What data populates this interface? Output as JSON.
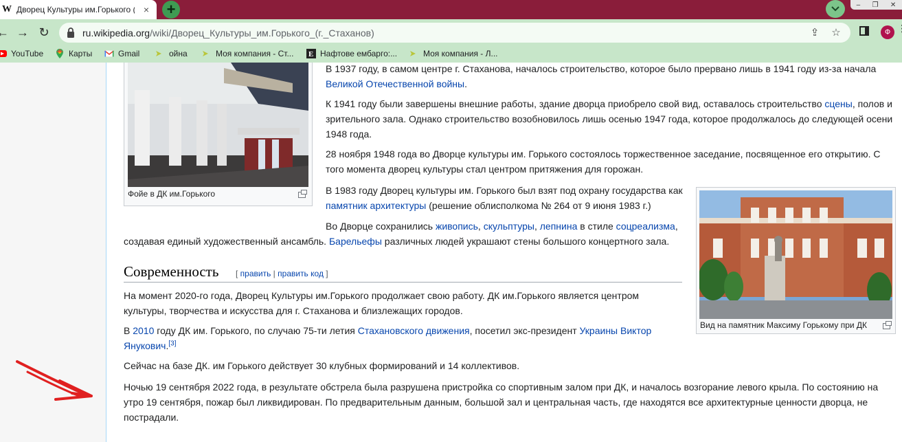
{
  "browser": {
    "tab_title": "Дворец Культуры им.Горького (",
    "tab_favicon": "W",
    "tab_close": "×",
    "new_tab": "+",
    "profile_letter": "Ф",
    "url_host": "ru.wikipedia.org",
    "url_path": "/wiki/Дворец_Культуры_им.Горького_(г._Стаханов)",
    "bookmarks": [
      {
        "label": "YouTube",
        "icon": "youtube-icon"
      },
      {
        "label": "Карты",
        "icon": "maps-icon"
      },
      {
        "label": "Gmail",
        "icon": "gmail-icon"
      },
      {
        "label": "ойна",
        "icon": "folder-arrow-icon"
      },
      {
        "label": "Моя компания - Ст...",
        "icon": "folder-arrow-icon"
      },
      {
        "label": "Нафтове ембарго:...",
        "icon": "letter-e-icon"
      },
      {
        "label": "Моя компания - Л...",
        "icon": "folder-arrow-icon"
      }
    ],
    "accent": "#8a1d3a",
    "toolbar_color": "#c7e6c9"
  },
  "article": {
    "p1_text": "В 1937 году, в самом центре г. Стаханова, началось строительство, которое было прервано лишь в 1941 году из-за начала",
    "p1_link": "Великой Отечественной войны",
    "p1_end": ".",
    "p2_a": "К 1941 году были завершены внешние работы, здание дворца приобрело свой вид, оставалось строительство ",
    "p2_link": "сцены",
    "p2_b": ", полов и",
    "p2_line2": "зрительного зала. Однако строительство возобновилось лишь осенью 1947 года, которое продолжалось до следующей осени",
    "p2_line3": "1948 года.",
    "p3_line1": "28 ноября 1948 года во Дворце культуры им. Горького состоялось торжественное заседание, посвященное его открытию. С",
    "p3_line2": "того момента дворец культуры стал центром притяжения для горожан.",
    "p4_line1": "В 1983 году Дворец культуры им. Горького был взят под охрану государства как",
    "p4_link": "памятник архитектуры",
    "p4_rest": " (решение облисполкома № 264 от 9 июня 1983 г.)",
    "p5_a": "Во Дворце сохранились ",
    "p5_l1": "живопись",
    "p5_c1": ", ",
    "p5_l2": "скульптуры",
    "p5_c2": ", ",
    "p5_l3": "лепнина",
    "p5_b": " в стиле ",
    "p5_l4": "соцреализма",
    "p5_c3": ",",
    "p5_line2_a": "создавая единый художественный ансамбль. ",
    "p5_l5": "Барельефы",
    "p5_line2_b": " различных людей украшают стены большого концертного зала.",
    "section_title": "Современность",
    "edit_open": "[ ",
    "edit_link": "править",
    "edit_sep": " | ",
    "edit_code_link": "править код",
    "edit_close": " ]",
    "p6_line1": "На момент 2020-го года, Дворец Культуры им.Горького продолжает свою работу. ДК им.Горького является центром",
    "p6_line2": "культуры, творчества и искусства для г. Стаханова и близлежащих городов.",
    "p7_a": "В ",
    "p7_l1": "2010",
    "p7_b": " году ДК им. Горького, по случаю 75-ти летия ",
    "p7_l2": "Стахановского движения",
    "p7_c": ", посетил экс-президент ",
    "p7_l3": "Украины",
    "p7_sp": " ",
    "p7_l4": "Виктор",
    "p7_line2_l": "Янукович",
    "p7_line2_dot": ".",
    "p7_ref": "[3]",
    "p8": "Сейчас на базе ДК. им Горького действует 30 клубных формирований и 14 коллективов.",
    "p9_line1": "Ночью 19 сентября 2022 года, в результате обстрела была разрушена пристройка со спортивным залом при ДК, и началось возгорание левого крыла. По состоянию на",
    "p9_line2": "утро 19 сентября, пожар был ликвидирован. По предварительным данным, большой зал и центральная часть, где находятся все архитектурные ценности дворца, не",
    "p9_line3": "пострадали.",
    "caption_foyer": "Фойе в ДК им.Горького",
    "caption_monument": "Вид на памятник Максиму Горькому при ДК",
    "link_color": "#0645ad"
  }
}
